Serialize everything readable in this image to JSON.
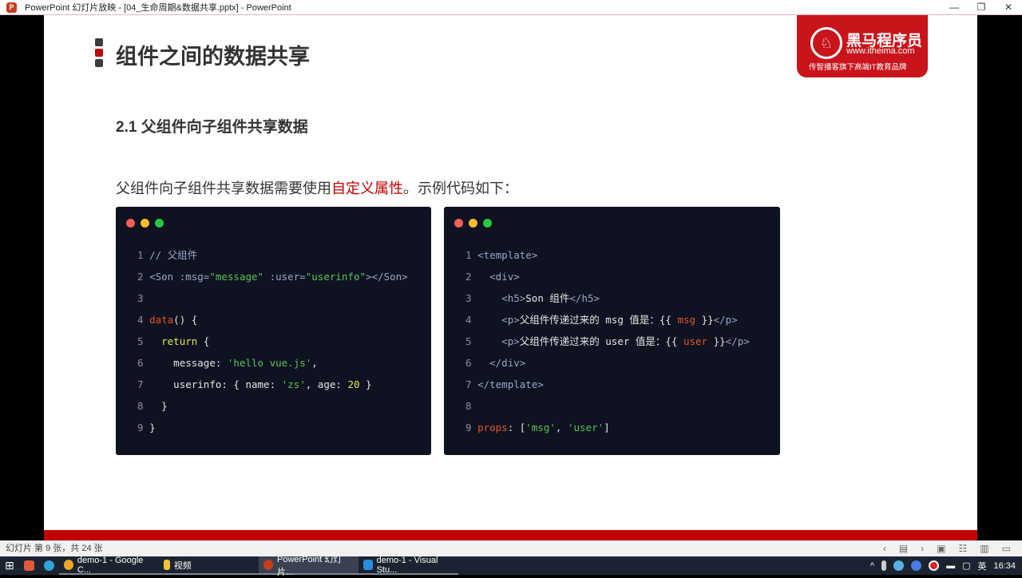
{
  "window": {
    "title": "PowerPoint 幻灯片放映 - [04_生命周期&数据共享.pptx] - PowerPoint",
    "minimize": "—",
    "restore": "❐",
    "close": "✕"
  },
  "slide": {
    "title": "组件之间的数据共享",
    "logo": {
      "name": "黑马程序员",
      "url": "www.itheima.com",
      "slogan": "传智播客旗下高端IT教育品牌"
    },
    "subtitle": "2.1 父组件向子组件共享数据",
    "desc_pre": "父组件向子组件共享数据需要使用",
    "desc_highlight": "自定义属性",
    "desc_post": "。示例代码如下：",
    "colors": {
      "accent": "#c00000",
      "code_bg": "#0f1221"
    },
    "code_left": [
      [
        [
          "1 ",
          "n"
        ],
        [
          "// 父组件",
          "t"
        ]
      ],
      [
        [
          "2 ",
          "n"
        ],
        [
          "<Son :msg=",
          "t"
        ],
        [
          "\"message\"",
          "s"
        ],
        [
          " :user=",
          "t"
        ],
        [
          "\"userinfo\"",
          "s"
        ],
        [
          "></Son>",
          "t"
        ]
      ],
      [
        [
          "3",
          "n"
        ]
      ],
      [
        [
          "4 ",
          "n"
        ],
        [
          "data",
          "k"
        ],
        [
          "() {",
          "p"
        ]
      ],
      [
        [
          "5 ",
          "n"
        ],
        [
          "  return",
          "y"
        ],
        [
          " {",
          "p"
        ]
      ],
      [
        [
          "6 ",
          "n"
        ],
        [
          "    message: ",
          "p"
        ],
        [
          "'hello vue.js'",
          "s"
        ],
        [
          ",",
          "p"
        ]
      ],
      [
        [
          "7 ",
          "n"
        ],
        [
          "    userinfo: { name: ",
          "p"
        ],
        [
          "'zs'",
          "s"
        ],
        [
          ", age: ",
          "p"
        ],
        [
          "20",
          "y"
        ],
        [
          " }",
          "p"
        ]
      ],
      [
        [
          "8 ",
          "n"
        ],
        [
          "  }",
          "p"
        ]
      ],
      [
        [
          "9 ",
          "n"
        ],
        [
          "}",
          "p"
        ]
      ]
    ],
    "code_right": [
      [
        [
          "1 ",
          "n"
        ],
        [
          "<template>",
          "t"
        ]
      ],
      [
        [
          "2 ",
          "n"
        ],
        [
          "  <div>",
          "t"
        ]
      ],
      [
        [
          "3 ",
          "n"
        ],
        [
          "    <h5>",
          "t"
        ],
        [
          "Son 组件",
          "p"
        ],
        [
          "</h5>",
          "t"
        ]
      ],
      [
        [
          "4 ",
          "n"
        ],
        [
          "    <p>",
          "t"
        ],
        [
          "父组件传递过来的 msg 值是：{{ ",
          "p"
        ],
        [
          "msg",
          "k"
        ],
        [
          " }}",
          "p"
        ],
        [
          "</p>",
          "t"
        ]
      ],
      [
        [
          "5 ",
          "n"
        ],
        [
          "    <p>",
          "t"
        ],
        [
          "父组件传递过来的 user 值是：{{ ",
          "p"
        ],
        [
          "user",
          "k"
        ],
        [
          " }}",
          "p"
        ],
        [
          "</p>",
          "t"
        ]
      ],
      [
        [
          "6 ",
          "n"
        ],
        [
          "  </div>",
          "t"
        ]
      ],
      [
        [
          "7 ",
          "n"
        ],
        [
          "</template>",
          "t"
        ]
      ],
      [
        [
          "8",
          "n"
        ]
      ],
      [
        [
          "9 ",
          "n"
        ],
        [
          "props",
          "k"
        ],
        [
          ": [",
          "p"
        ],
        [
          "'msg'",
          "s"
        ],
        [
          ", ",
          "p"
        ],
        [
          "'user'",
          "s"
        ],
        [
          "]",
          "p"
        ]
      ]
    ]
  },
  "statusbar": {
    "slide_info": "幻灯片 第 9 张，共 24 张",
    "icons": [
      "‹",
      "▤",
      "›",
      "▣",
      "☷",
      "▥",
      "▭"
    ]
  },
  "taskbar": {
    "apps": [
      {
        "label": "demo-1 - Google C...",
        "color": "#e9a628"
      },
      {
        "label": "视频",
        "color": "#f2c232"
      },
      {
        "label": "PowerPoint 幻灯片...",
        "color": "#c43e1c"
      },
      {
        "label": "demo-1 - Visual Stu...",
        "color": "#2a8de0"
      }
    ],
    "ime": "英",
    "time": "16:34"
  }
}
